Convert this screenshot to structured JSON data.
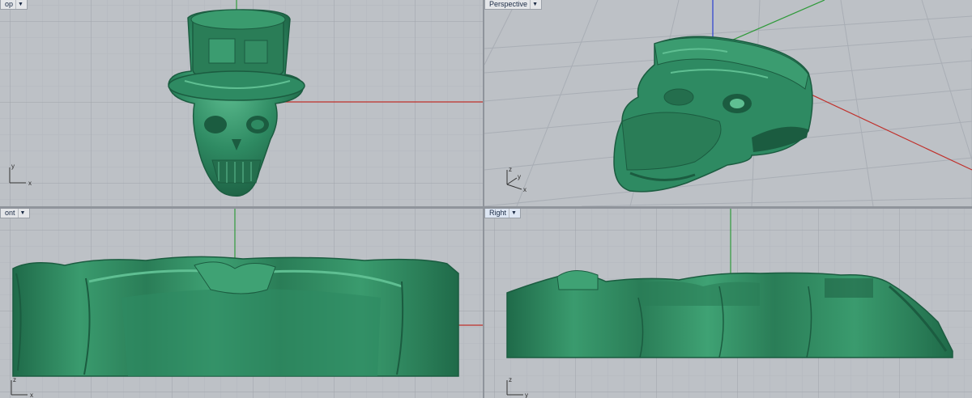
{
  "viewports": {
    "top": {
      "label": "Top",
      "visible_label": "op",
      "dropdown_icon": "triangle-down-icon"
    },
    "perspective": {
      "label": "Perspective"
    },
    "front": {
      "label": "Front",
      "visible_label": "ont"
    },
    "right": {
      "label": "Right"
    }
  },
  "axis_labels": {
    "x": "x",
    "y": "y",
    "z": "z"
  },
  "colors": {
    "viewport_bg": "#bdc1c6",
    "grid_minor": "#b3b7bd",
    "grid_major": "#9ea3aa",
    "x_axis": "#c0302b",
    "y_axis": "#2f9a3a",
    "z_axis": "#2a3fcf",
    "model_green": "#2e8a62",
    "model_dark": "#1b5c40",
    "model_light": "#5fbf92",
    "active_tab": "#dde6f3"
  }
}
